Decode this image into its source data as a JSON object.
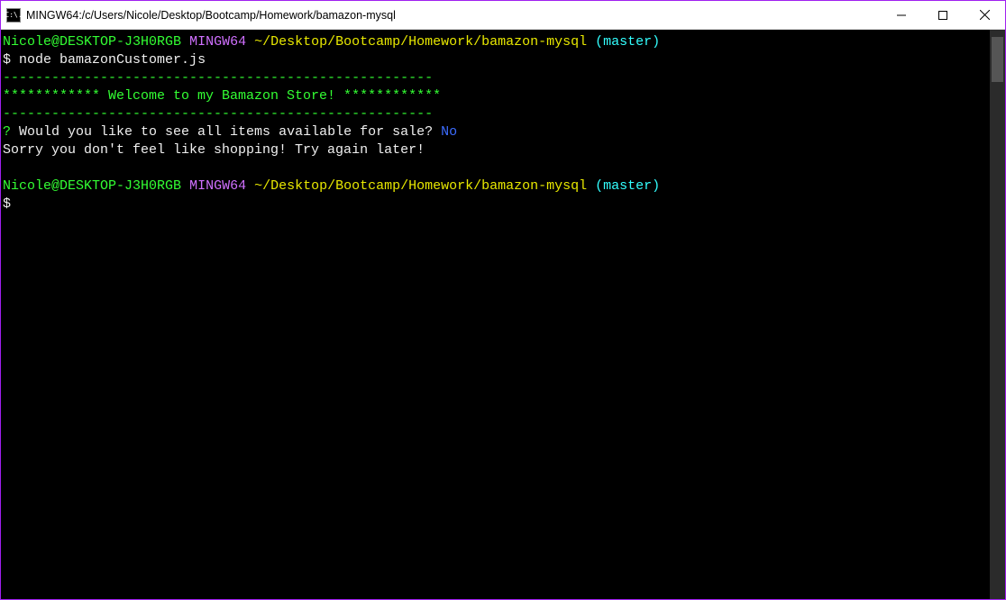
{
  "window": {
    "title": "MINGW64:/c/Users/Nicole/Desktop/Bootcamp/Homework/bamazon-mysql",
    "icon_label": "C:\\."
  },
  "term": {
    "prompt1_user": "Nicole@DESKTOP-J3H0RGB",
    "prompt1_env": "MINGW64",
    "prompt1_path": "~/Desktop/Bootcamp/Homework/bamazon-mysql",
    "prompt1_branch": "(master)",
    "prompt1_symbol": "$",
    "cmd1": "node bamazonCustomer.js",
    "divider1": "-----------------------------------------------------",
    "banner": "************ Welcome to my Bamazon Store! ************",
    "divider2": "-----------------------------------------------------",
    "question_mark": "?",
    "question_text": " Would you like to see all items available for sale?",
    "answer": " No",
    "sorry": "Sorry you don't feel like shopping! Try again later!",
    "blank": " ",
    "prompt2_user": "Nicole@DESKTOP-J3H0RGB",
    "prompt2_env": "MINGW64",
    "prompt2_path": "~/Desktop/Bootcamp/Homework/bamazon-mysql",
    "prompt2_branch": "(master)",
    "prompt2_symbol": "$"
  }
}
